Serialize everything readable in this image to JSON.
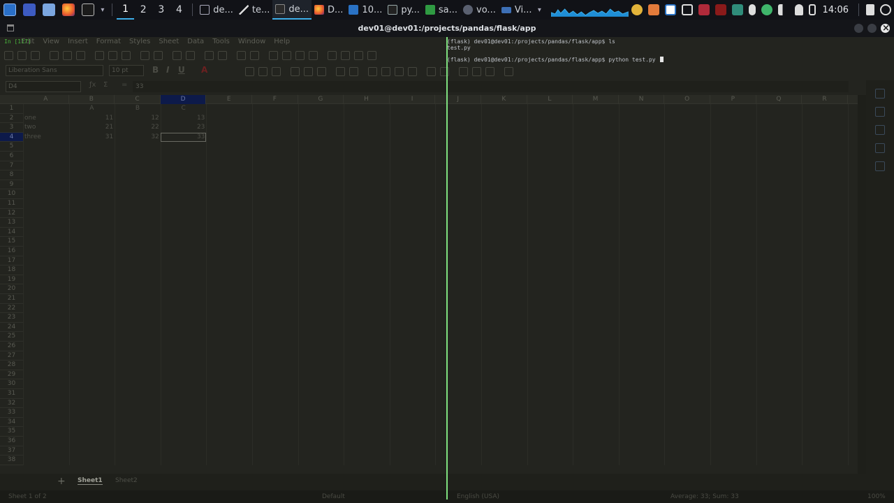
{
  "panel": {
    "desktops": [
      "1",
      "2",
      "3",
      "4"
    ],
    "tasks": [
      {
        "label": "de...",
        "icon": "image-viewer-icon"
      },
      {
        "label": "te...",
        "icon": "text-editor-icon"
      },
      {
        "label": "de...",
        "icon": "terminal-icon"
      },
      {
        "label": "D...",
        "icon": "firefox-icon"
      },
      {
        "label": "10...",
        "icon": "vscode-icon"
      },
      {
        "label": "py...",
        "icon": "document-icon"
      },
      {
        "label": "sa...",
        "icon": "spreadsheet-icon"
      },
      {
        "label": "vo...",
        "icon": "network-icon"
      },
      {
        "label": "Vi...",
        "icon": "window-icon"
      }
    ],
    "clock": "14:06"
  },
  "window": {
    "title": "dev01@dev01:/projects/pandas/flask/app"
  },
  "calc": {
    "menu": [
      "Edit",
      "View",
      "Insert",
      "Format",
      "Styles",
      "Sheet",
      "Data",
      "Tools",
      "Window",
      "Help"
    ],
    "font_name": "Liberation Sans",
    "font_size": "10 pt",
    "name_box": "D4",
    "formula": "33",
    "columns": [
      "A",
      "B",
      "C",
      "D",
      "E",
      "F",
      "G",
      "H",
      "I",
      "J",
      "K",
      "L",
      "M",
      "N",
      "O",
      "P",
      "Q",
      "R"
    ],
    "rows": [
      "1",
      "2",
      "3",
      "4",
      "5",
      "6",
      "7",
      "8",
      "9",
      "10",
      "11",
      "12",
      "13",
      "14",
      "15",
      "16",
      "17",
      "18",
      "19",
      "20",
      "21",
      "22",
      "23",
      "24",
      "25",
      "26",
      "27",
      "28",
      "29",
      "30",
      "31",
      "32",
      "33",
      "34",
      "35",
      "36",
      "37",
      "38"
    ],
    "header_row": [
      "A",
      "B",
      "C"
    ],
    "data_rows": [
      {
        "label": "one",
        "b": "11",
        "c": "12",
        "d": "13"
      },
      {
        "label": "two",
        "b": "21",
        "c": "22",
        "d": "23"
      },
      {
        "label": "three",
        "b": "31",
        "c": "32",
        "d": "33"
      }
    ],
    "sheets": [
      "Sheet1",
      "Sheet2"
    ],
    "status": {
      "sheet_count": "Sheet 1 of 2",
      "style": "Default",
      "language": "English (USA)",
      "summary": "Average: 33; Sum: 33",
      "zoom": "100%"
    }
  },
  "terminal": {
    "insert_label": "In [117]",
    "lines": [
      "(flask) dev01@dev01:/projects/pandas/flask/app$ ls",
      "test.py",
      "",
      "(flask) dev01@dev01:/projects/pandas/flask/app$ python test.py "
    ]
  },
  "colors": {
    "panel_bg": "#111217",
    "accent": "#3daee9",
    "split_line": "#7fe07f",
    "selected_header": "#0d1a4a"
  }
}
